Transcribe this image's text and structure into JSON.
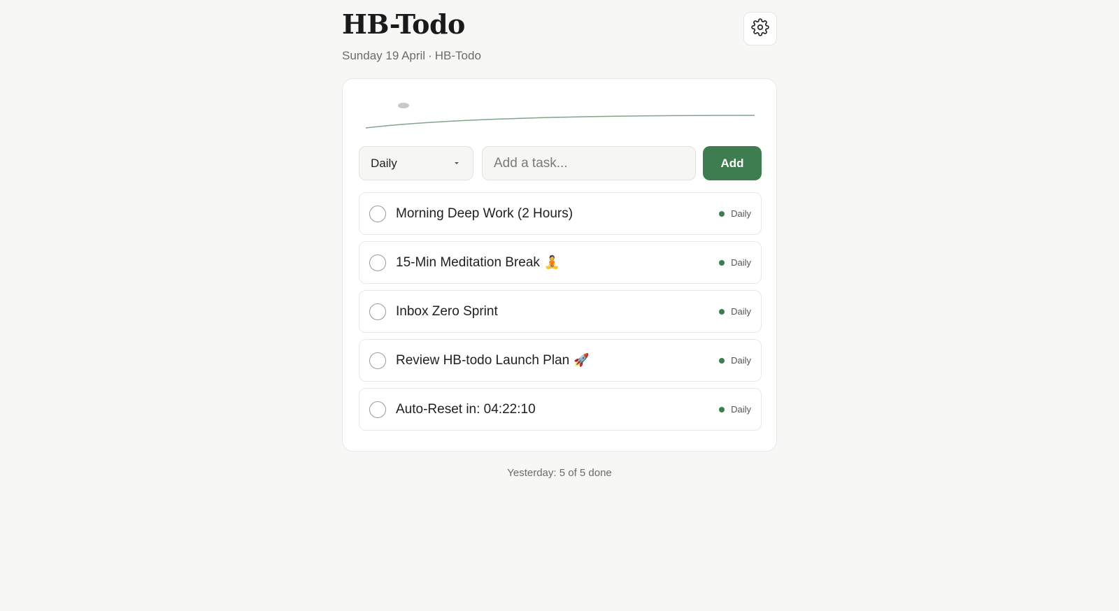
{
  "app": {
    "title": "HB-Todo",
    "date": "Sunday 19 April",
    "separator": "·",
    "subtitle_name": "HB-Todo"
  },
  "header": {
    "settings_icon": "gear-icon"
  },
  "controls": {
    "frequency_selected": "Daily",
    "task_placeholder": "Add a task...",
    "task_value": "",
    "add_label": "Add"
  },
  "tasks": [
    {
      "text": "Morning Deep Work (2 Hours)",
      "emoji": "",
      "tag": "Daily",
      "done": false
    },
    {
      "text": "15-Min Meditation Break",
      "emoji": "🧘",
      "tag": "Daily",
      "done": false
    },
    {
      "text": "Inbox Zero Sprint",
      "emoji": "",
      "tag": "Daily",
      "done": false
    },
    {
      "text": "Review HB-todo Launch Plan",
      "emoji": "🚀",
      "tag": "Daily",
      "done": false
    },
    {
      "text": "Auto-Reset in: 04:22:10",
      "emoji": "",
      "tag": "Daily",
      "done": false
    }
  ],
  "footer": {
    "yesterday_summary": "Yesterday: 5 of 5 done"
  },
  "colors": {
    "accent": "#3e7d4f",
    "background": "#f7f7f5",
    "card": "#ffffff",
    "sparkline": "#7fa58a"
  }
}
